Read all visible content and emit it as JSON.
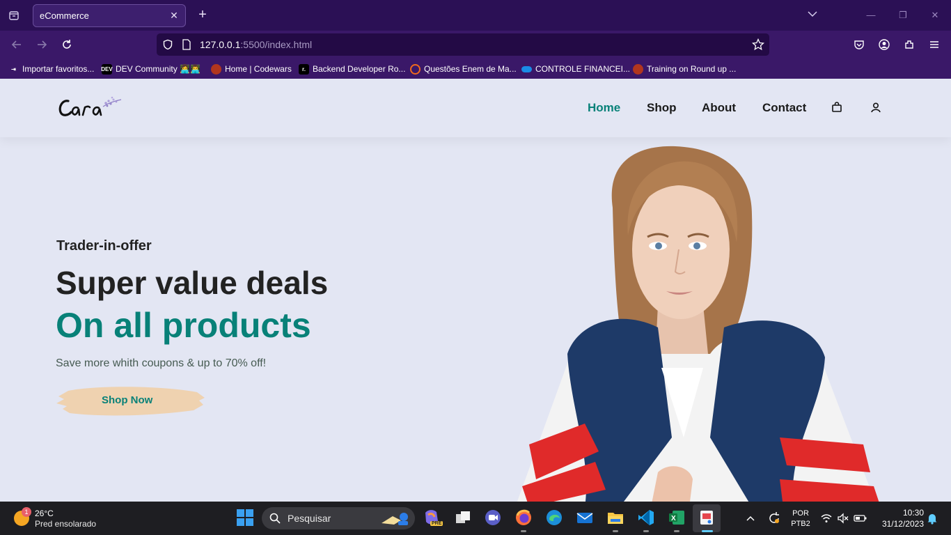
{
  "browser": {
    "tab_title": "eCommerce",
    "url_host": "127.0.0.1",
    "url_rest": ":5500/index.html",
    "bookmarks": [
      {
        "label": "Importar favoritos...",
        "icon": "import-icon"
      },
      {
        "label": "DEV Community 👩‍💻👨‍💻",
        "icon": "dev-icon"
      },
      {
        "label": "Home | Codewars",
        "icon": "codewars-icon"
      },
      {
        "label": "Backend Developer Ro...",
        "icon": "roadmap-icon"
      },
      {
        "label": "Questões Enem de Ma...",
        "icon": "qconcursos-icon"
      },
      {
        "label": "CONTROLE FINANCEI...",
        "icon": "onedrive-icon"
      },
      {
        "label": "Training on Round up ...",
        "icon": "codewars-icon"
      }
    ],
    "dev_badge": "DEV"
  },
  "site": {
    "nav": [
      {
        "label": "Home",
        "active": true
      },
      {
        "label": "Shop",
        "active": false
      },
      {
        "label": "About",
        "active": false
      },
      {
        "label": "Contact",
        "active": false
      }
    ],
    "logo_text": "Cara",
    "accent_color": "#088178"
  },
  "hero": {
    "kicker": "Trader-in-offer",
    "headline": "Super value deals",
    "headline_accent": "On all products",
    "subtitle": "Save more whith coupons & up to 70% off!",
    "button_label": "Shop Now"
  },
  "taskbar": {
    "weather_temp": "26°C",
    "weather_desc": "Pred ensolarado",
    "weather_badge": "1",
    "search_label": "Pesquisar",
    "lang_1": "POR",
    "lang_2": "PTB2",
    "time": "10:30",
    "date": "31/12/2023",
    "copilot_badge": "PRE"
  }
}
